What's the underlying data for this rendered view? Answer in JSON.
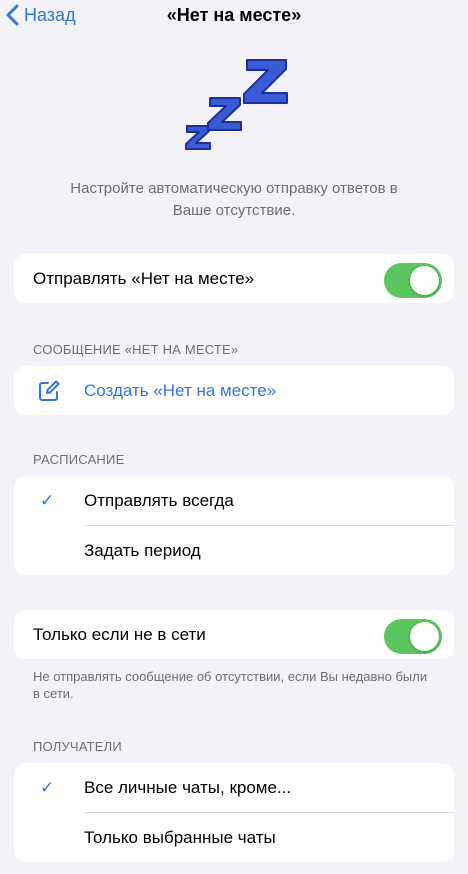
{
  "nav": {
    "back_label": "Назад",
    "title": "«Нет на месте»"
  },
  "hero": {
    "icon": "zzz-sleep-icon",
    "description": "Настройте автоматическую отправку ответов в Ваше отсутствие."
  },
  "send_away": {
    "label": "Отправлять «Нет на месте»",
    "enabled": true
  },
  "message_section": {
    "header": "СООБЩЕНИЕ «НЕТ НА МЕСТЕ»",
    "create_label": "Создать «Нет на месте»",
    "icon": "edit-icon"
  },
  "schedule": {
    "header": "РАСПИСАНИЕ",
    "options": [
      {
        "label": "Отправлять всегда",
        "checked": true
      },
      {
        "label": "Задать период",
        "checked": false
      }
    ]
  },
  "offline_only": {
    "label": "Только если не в сети",
    "enabled": true,
    "note": "Не отправлять сообщение об отсутствии, если Вы недавно были в сети."
  },
  "recipients": {
    "header": "ПОЛУЧАТЕЛИ",
    "options": [
      {
        "label": "Все личные чаты, кроме...",
        "checked": true
      },
      {
        "label": "Только выбранные чаты",
        "checked": false
      }
    ]
  },
  "colors": {
    "accent": "#3478d6",
    "toggle_on": "#5bc55e",
    "background": "#f2f2f7",
    "secondary_text": "#6d6d72"
  },
  "check_glyph": "✓"
}
